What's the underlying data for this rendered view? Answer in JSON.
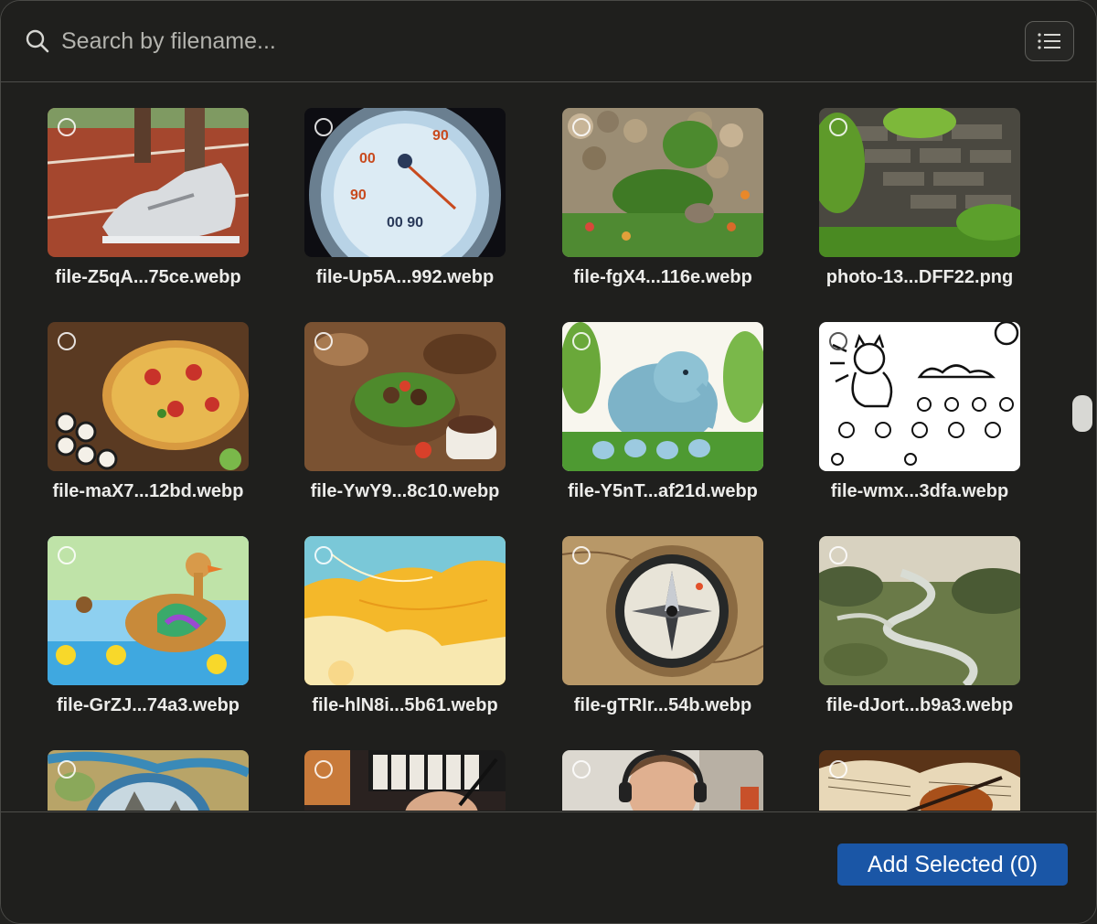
{
  "search": {
    "placeholder": "Search by filename...",
    "value": ""
  },
  "icons": {
    "search": "search-icon",
    "view_toggle": "list-view-icon",
    "select": "radio-circle-icon"
  },
  "files": [
    {
      "name": "file-Z5qA...75ce.webp"
    },
    {
      "name": "file-Up5A...992.webp"
    },
    {
      "name": "file-fgX4...116e.webp"
    },
    {
      "name": "photo-13...DFF22.png"
    },
    {
      "name": "file-maX7...12bd.webp"
    },
    {
      "name": "file-YwY9...8c10.webp"
    },
    {
      "name": "file-Y5nT...af21d.webp"
    },
    {
      "name": "file-wmx...3dfa.webp"
    },
    {
      "name": "file-GrZJ...74a3.webp"
    },
    {
      "name": "file-hlN8i...5b61.webp"
    },
    {
      "name": "file-gTRIr...54b.webp"
    },
    {
      "name": "file-dJort...b9a3.webp"
    },
    {
      "name": ""
    },
    {
      "name": ""
    },
    {
      "name": ""
    },
    {
      "name": ""
    }
  ],
  "footer": {
    "add_button_label": "Add Selected (0)"
  },
  "colors": {
    "background": "#1f1f1d",
    "accent": "#1a56a6",
    "text": "#ececea"
  }
}
